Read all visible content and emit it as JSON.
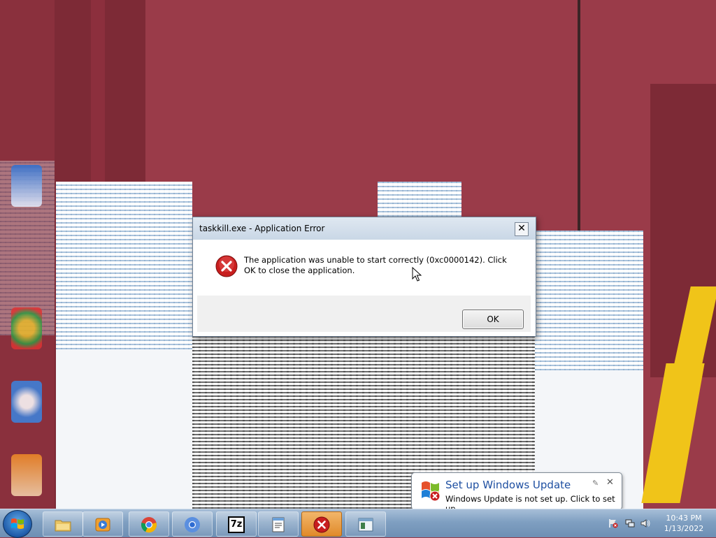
{
  "dialog": {
    "title": "taskkill.exe - Application Error",
    "close_glyph": "✕",
    "message": "The application was unable to start correctly (0xc0000142). Click OK to close the application.",
    "ok_label": "OK",
    "icon": "error-icon"
  },
  "balloon": {
    "title": "Set up Windows Update",
    "text": "Windows Update is not set up. Click to set up.",
    "close_glyph": "✕",
    "pin_glyph": "✎",
    "icon": "windows-flag-error-icon"
  },
  "taskbar": {
    "start_icon": "windows-start-icon",
    "items": [
      {
        "name": "explorer",
        "icon": "folder-icon"
      },
      {
        "name": "media-player",
        "icon": "media-player-icon"
      },
      {
        "name": "chrome",
        "icon": "chrome-icon"
      },
      {
        "name": "chromium",
        "icon": "chromium-icon"
      },
      {
        "name": "7zip",
        "icon": "7zip-icon",
        "label": "7z"
      },
      {
        "name": "notepad",
        "icon": "notepad-icon"
      },
      {
        "name": "error-window",
        "icon": "error-icon",
        "active": true
      },
      {
        "name": "window",
        "icon": "window-icon"
      }
    ]
  },
  "tray": {
    "time": "10:43 PM",
    "date": "1/13/2022",
    "icons": [
      "action-center-error-icon",
      "network-icon",
      "volume-icon"
    ]
  },
  "colors": {
    "desktop": "#9a3b49",
    "balloon_title": "#1e4fa1",
    "active_taskbar": "#e08a2a"
  }
}
